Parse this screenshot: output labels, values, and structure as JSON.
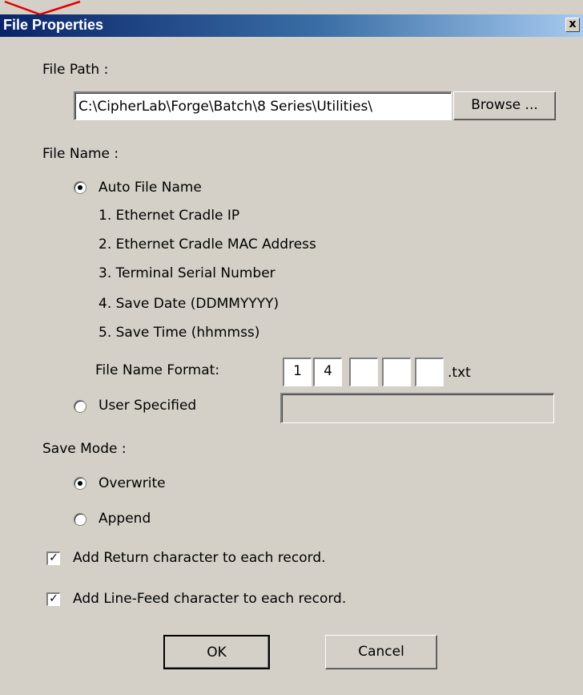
{
  "dialog": {
    "title": "File Properties",
    "close_label": "x"
  },
  "file_path": {
    "label": "File Path :",
    "value": "C:\\CipherLab\\Forge\\Batch\\8 Series\\Utilities\\",
    "browse_label": "Browse ..."
  },
  "file_name": {
    "label": "File Name :",
    "auto_label": "Auto File Name",
    "auto_selected": true,
    "options": [
      "1. Ethernet Cradle IP",
      "2. Ethernet Cradle MAC Address",
      "3. Terminal Serial Number",
      "4. Save Date (DDMMYYYY)",
      "5. Save Time (hhmmss)"
    ],
    "format_label": "File Name Format:",
    "format_values": [
      "1",
      "4",
      "",
      "",
      ""
    ],
    "format_ext": ".txt",
    "user_label": "User Specified",
    "user_selected": false,
    "user_value": ""
  },
  "save_mode": {
    "label": "Save Mode :",
    "overwrite_label": "Overwrite",
    "overwrite_selected": true,
    "append_label": "Append",
    "append_selected": false
  },
  "options": {
    "add_return_label": "Add Return character to each record.",
    "add_return_checked": true,
    "add_linefeed_label": "Add Line-Feed character to each record.",
    "add_linefeed_checked": true
  },
  "buttons": {
    "ok_label": "OK",
    "cancel_label": "Cancel"
  },
  "colors": {
    "dialog_bg": "#d4d0c8",
    "title_start": "#0a246a",
    "title_end": "#a6caf0",
    "annotation": "#e00000"
  }
}
